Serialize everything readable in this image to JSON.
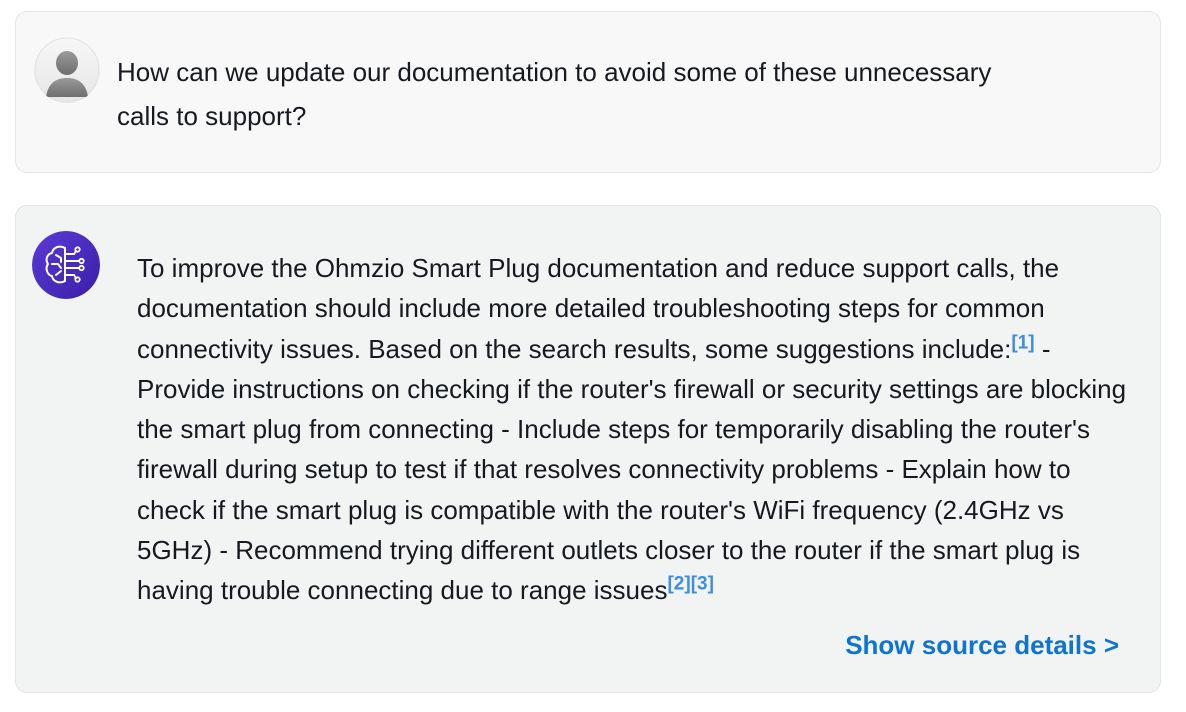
{
  "user_message": {
    "text": "How can we update our documentation to avoid some of these unnecessary calls to support?"
  },
  "assistant_message": {
    "intro": "To improve the Ohmzio Smart Plug documentation and reduce support calls, the documentation should include more detailed troubleshooting steps for common connectivity issues. Based on the search results, some suggestions include:",
    "citation_1": "[1]",
    "body": " - Provide instructions on checking if the router's firewall or security settings are blocking the smart plug from connecting - Include steps for temporarily disabling the router's firewall during setup to test if that resolves connectivity problems - Explain how to check if the smart plug is compatible with the router's WiFi frequency (2.4GHz vs 5GHz) - Recommend trying different outlets closer to the router if the smart plug is having trouble connecting due to range issues",
    "citation_2": "[2]",
    "citation_3": "[3]",
    "source_link_label": "Show source details >"
  },
  "icons": {
    "user_avatar": "user-silhouette-icon",
    "assistant_avatar": "ai-brain-circuit-icon"
  },
  "colors": {
    "citation": "#3b8fe0",
    "link": "#0f73d1",
    "assistant_avatar_bg": "#4b2dc4"
  }
}
